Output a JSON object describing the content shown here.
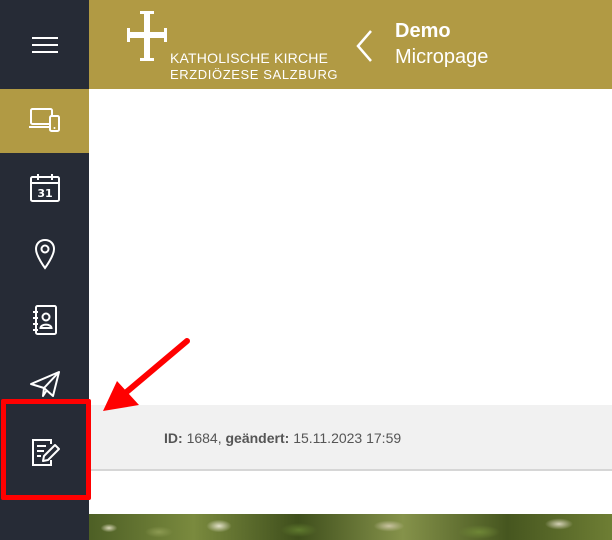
{
  "sidebar": {
    "items": [
      {
        "name": "menu-icon"
      },
      {
        "name": "devices-icon",
        "active": true
      },
      {
        "name": "calendar-icon",
        "text": "31"
      },
      {
        "name": "location-pin-icon"
      },
      {
        "name": "contacts-icon"
      },
      {
        "name": "paper-plane-icon"
      },
      {
        "name": "edit-document-icon",
        "highlighted": true
      }
    ]
  },
  "header": {
    "logo_line1": "KATHOLISCHE KIRCHE",
    "logo_line2": "ERZDIÖZESE SALZBURG",
    "title": "Demo",
    "subtitle": "Micropage",
    "back_icon": "chevron-left-icon"
  },
  "meta": {
    "id_label": "ID:",
    "id_value": "1684",
    "changed_label": "geändert:",
    "changed_value": "15.11.2023 17:59"
  },
  "colors": {
    "sidebar_bg": "#262b36",
    "accent": "#b19a44",
    "annotation": "#ff0000"
  }
}
